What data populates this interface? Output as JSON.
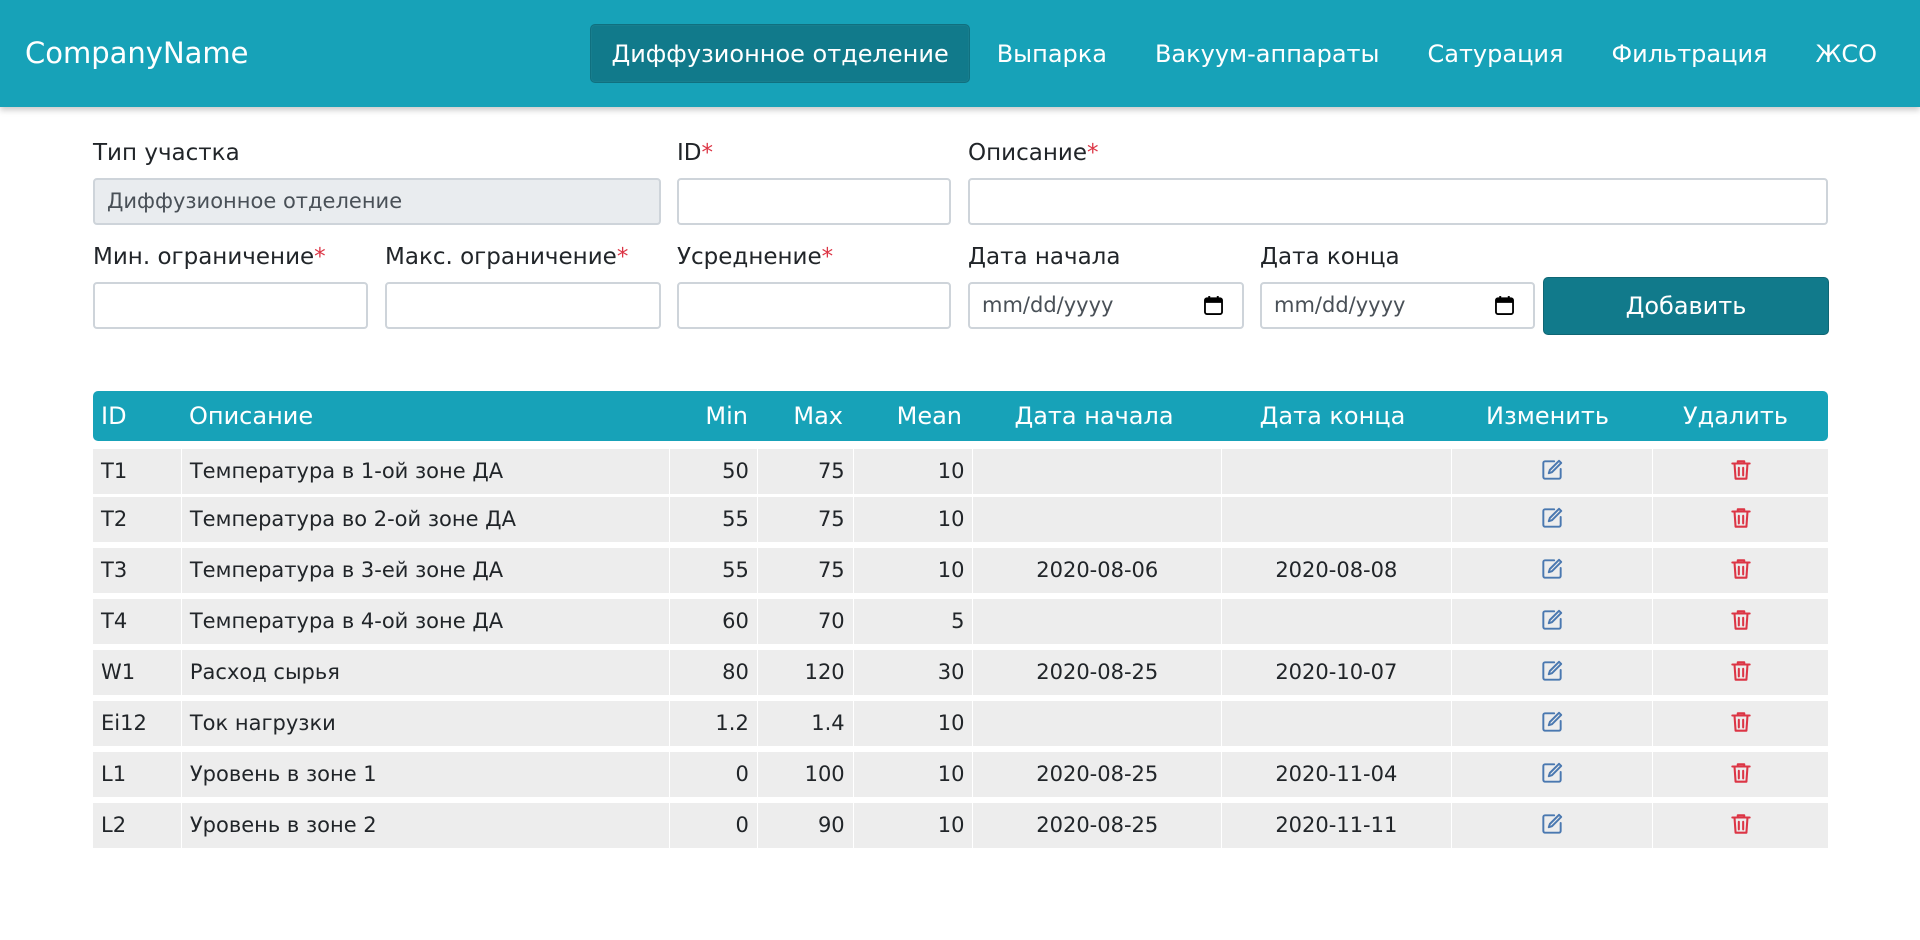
{
  "navbar": {
    "brand": "CompanyName",
    "links": [
      {
        "label": "Диффузионное отделение",
        "active": true
      },
      {
        "label": "Выпарка"
      },
      {
        "label": "Вакуум-аппараты"
      },
      {
        "label": "Сатурация"
      },
      {
        "label": "Фильтрация"
      },
      {
        "label": "ЖСО"
      }
    ]
  },
  "form": {
    "section_type_label": "Тип участка",
    "section_type_value": "Диффузионное отделение",
    "id_label": "ID",
    "description_label": "Описание",
    "min_label": "Мин. ограничение",
    "max_label": "Макс. ограничение",
    "mean_label": "Усреднение",
    "start_date_label": "Дата начала",
    "start_date_placeholder": "mm/dd/yyyy",
    "end_date_label": "Дата конца",
    "end_date_placeholder": "mm/dd/yyyy",
    "required_mark": "*",
    "add_button": "Добавить"
  },
  "table": {
    "headers": [
      "ID",
      "Описание",
      "Min",
      "Max",
      "Mean",
      "Дата начала",
      "Дата конца",
      "Изменить",
      "Удалить"
    ],
    "rows": [
      {
        "id": "T1",
        "desc": "Температура в 1-ой зоне ДА",
        "min": "50",
        "max": "75",
        "mean": "10",
        "start": "",
        "end": ""
      },
      {
        "id": "T2",
        "desc": "Температура во 2-ой зоне ДА",
        "min": "55",
        "max": "75",
        "mean": "10",
        "start": "",
        "end": ""
      },
      {
        "id": "T3",
        "desc": "Температура в 3-ей зоне ДА",
        "min": "55",
        "max": "75",
        "mean": "10",
        "start": "2020-08-06",
        "end": "2020-08-08"
      },
      {
        "id": "T4",
        "desc": "Температура в 4-ой зоне ДА",
        "min": "60",
        "max": "70",
        "mean": "5",
        "start": "",
        "end": ""
      },
      {
        "id": "W1",
        "desc": "Расход сырья",
        "min": "80",
        "max": "120",
        "mean": "30",
        "start": "2020-08-25",
        "end": "2020-10-07"
      },
      {
        "id": "Ei12",
        "desc": "Ток нагрузки",
        "min": "1.2",
        "max": "1.4",
        "mean": "10",
        "start": "",
        "end": ""
      },
      {
        "id": "L1",
        "desc": "Уровень в зоне 1",
        "min": "0",
        "max": "100",
        "mean": "10",
        "start": "2020-08-25",
        "end": "2020-11-04"
      },
      {
        "id": "L2",
        "desc": "Уровень в зоне 2",
        "min": "0",
        "max": "90",
        "mean": "10",
        "start": "2020-08-25",
        "end": "2020-11-11"
      }
    ],
    "edit_icon": "edit-icon",
    "delete_icon": "trash-icon"
  },
  "colors": {
    "primary": "#17a2b8",
    "primary_dark": "#117a8b",
    "edit_icon": "#4a78b0",
    "delete_icon": "#dc3545",
    "row_bg": "#ededed"
  }
}
